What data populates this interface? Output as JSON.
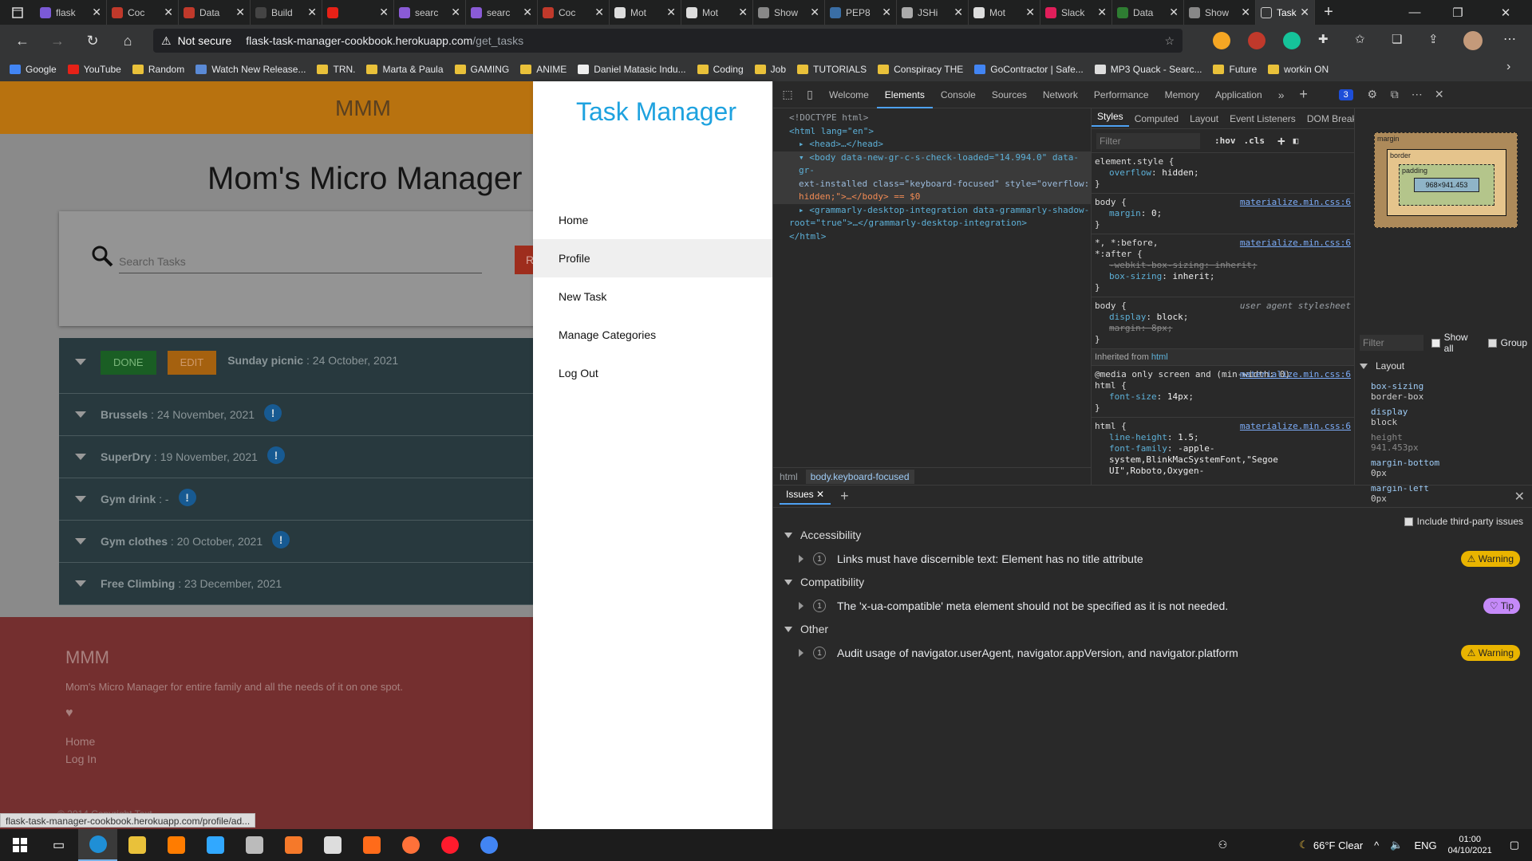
{
  "browser": {
    "tabs": [
      {
        "label": "flask",
        "color": "#7b5ad6"
      },
      {
        "label": "Coc",
        "color": "#c0392b"
      },
      {
        "label": "Data",
        "color": "#c0392b"
      },
      {
        "label": "Build",
        "color": "#444"
      },
      {
        "label": "",
        "color": "#e62117"
      },
      {
        "label": "searc",
        "color": "#8a5bd6"
      },
      {
        "label": "searc",
        "color": "#8a5bd6"
      },
      {
        "label": "Coc",
        "color": "#c0392b"
      },
      {
        "label": "Mot",
        "color": "#ddd"
      },
      {
        "label": "Mot",
        "color": "#ddd"
      },
      {
        "label": "Show",
        "color": "#888"
      },
      {
        "label": "PEP8",
        "color": "#3a6ea5"
      },
      {
        "label": "JSHi",
        "color": "#aaa"
      },
      {
        "label": "Mot",
        "color": "#ddd"
      },
      {
        "label": "Slack",
        "color": "#e01e5a"
      },
      {
        "label": "Data",
        "color": "#2e7d32"
      },
      {
        "label": "Show",
        "color": "#888"
      }
    ],
    "active_tab": "Task",
    "address": {
      "warning": "Not secure",
      "host": "flask-task-manager-cookbook.herokuapp.com",
      "path": "/get_tasks"
    },
    "bookmarks": [
      {
        "label": "Google",
        "color": "#4285f4"
      },
      {
        "label": "YouTube",
        "color": "#e62117"
      },
      {
        "label": "Random",
        "color": "#e9c13a"
      },
      {
        "label": "Watch New Release...",
        "color": "#5a8ad6"
      },
      {
        "label": "TRN.",
        "color": "#e9c13a"
      },
      {
        "label": "Marta & Paula",
        "color": "#e9c13a"
      },
      {
        "label": "GAMING",
        "color": "#e9c13a"
      },
      {
        "label": "ANIME",
        "color": "#e9c13a"
      },
      {
        "label": "Daniel Matasic Indu...",
        "color": "#eee"
      },
      {
        "label": "Coding",
        "color": "#e9c13a"
      },
      {
        "label": "Job",
        "color": "#e9c13a"
      },
      {
        "label": "TUTORIALS",
        "color": "#e9c13a"
      },
      {
        "label": "Conspiracy THE",
        "color": "#e9c13a"
      },
      {
        "label": "GoContractor | Safe...",
        "color": "#4285f4"
      },
      {
        "label": "MP3 Quack - Searc...",
        "color": "#ddd"
      },
      {
        "label": "Future",
        "color": "#e9c13a"
      },
      {
        "label": "workin ON",
        "color": "#e9c13a"
      }
    ]
  },
  "site": {
    "brand": "MMM",
    "title": "Mom's Micro Manager",
    "search_placeholder": "Search Tasks",
    "reset_label": "R",
    "done_label": "DONE",
    "edit_label": "EDIT",
    "tasks": [
      {
        "name": "Sunday picnic",
        "date": " : 24 October, 2021",
        "info": false
      },
      {
        "name": "Brussels",
        "date": " : 24 November, 2021",
        "info": true
      },
      {
        "name": "SuperDry",
        "date": " : 19 November, 2021",
        "info": true
      },
      {
        "name": "Gym drink",
        "date": " : -",
        "info": true
      },
      {
        "name": "Gym clothes",
        "date": " : 20 October, 2021",
        "info": true
      },
      {
        "name": "Free Climbing",
        "date": " : 23 December, 2021",
        "info": false
      }
    ],
    "footer": {
      "brand": "MMM",
      "description": "Mom's Micro Manager for entire family and all the needs of it on one spot.",
      "links": [
        "Home",
        "Log In"
      ],
      "copyright": "© 2014 Copyright Text"
    },
    "status_url": "flask-task-manager-cookbook.herokuapp.com/profile/ad..."
  },
  "sidenav": {
    "logo": "Task Manager",
    "items": [
      "Home",
      "Profile",
      "New Task",
      "Manage Categories",
      "Log Out"
    ]
  },
  "devtools": {
    "tabs": [
      "Welcome",
      "Elements",
      "Console",
      "Sources",
      "Network",
      "Performance",
      "Memory",
      "Application"
    ],
    "issue_count": "3",
    "dom": {
      "doctype": "<!DOCTYPE html>",
      "html_open": "<html lang=\"en\">",
      "head": "<head>…</head>",
      "body_line1": "<body data-new-gr-c-s-check-loaded=\"14.994.0\" data-gr-",
      "body_line2": "ext-installed class=\"keyboard-focused\" style=\"overflow:",
      "body_line3": "hidden;\">…</body> == $0",
      "gram_line1": "<grammarly-desktop-integration data-grammarly-shadow-",
      "gram_line2": "root=\"true\">…</grammarly-desktop-integration>",
      "html_close": "</html>"
    },
    "breadcrumb": [
      "html",
      "body.keyboard-focused"
    ],
    "styles_tabs": [
      "Styles",
      "Computed",
      "Layout",
      "Event Listeners",
      "DOM Breakpoints",
      "Properties"
    ],
    "filter_placeholder": "Filter",
    "hov": ":hov",
    "cls": ".cls",
    "rules": [
      {
        "selector": "element.style {",
        "props": [
          [
            "overflow",
            "hidden"
          ]
        ],
        "src": ""
      },
      {
        "selector": "body {",
        "props": [
          [
            "margin",
            "0"
          ]
        ],
        "src": "materialize.min.css:6"
      },
      {
        "selector": "*, *:before,\n*:after {",
        "props": [
          [
            "-webkit-box-sizing",
            "inherit",
            "strike"
          ],
          [
            "box-sizing",
            "inherit"
          ]
        ],
        "src": "materialize.min.css:6"
      },
      {
        "selector": "body {",
        "props": [
          [
            "display",
            "block"
          ],
          [
            "margin",
            "8px",
            "strike"
          ]
        ],
        "src": "user agent stylesheet"
      }
    ],
    "inherited": {
      "label": "Inherited from ",
      "tag": "html"
    },
    "media_rule": {
      "media": "@media only screen and (min-width: 0)",
      "selector": "html {",
      "props": [
        [
          "font-size",
          "14px"
        ]
      ],
      "src": "materialize.min.css:6"
    },
    "html_rule": {
      "selector": "html {",
      "props": [
        [
          "line-height",
          "1.5"
        ],
        [
          "font-family",
          "-apple-system,BlinkMacSystemFont,\"Segoe UI\",Roboto,Oxygen-"
        ]
      ],
      "src": "materialize.min.css:6"
    },
    "boxmodel": {
      "margin": "margin",
      "border": "border",
      "padding": "padding",
      "content": "968×941.453",
      "dash": "–"
    },
    "layout_filter": "Filter",
    "show_all": "Show all",
    "group": "Group",
    "layout_title": "Layout",
    "layout_props": [
      {
        "k": "box-sizing",
        "v": "border-box"
      },
      {
        "k": "display",
        "v": "block"
      },
      {
        "k": "height",
        "v": "941.453px",
        "grey": true
      },
      {
        "k": "margin-bottom",
        "v": "0px"
      },
      {
        "k": "margin-left",
        "v": "0px"
      }
    ],
    "drawer_tab": "Issues",
    "third_party": "Include third-party issues",
    "categories": [
      {
        "name": "Accessibility",
        "issue": "Links must have discernible text: Element has no title attribute",
        "count": "1",
        "badge": "⚠ Warning",
        "kind": "warn"
      },
      {
        "name": "Compatibility",
        "issue": "The 'x-ua-compatible' meta element should not be specified as it is not needed.",
        "count": "1",
        "badge": "♡ Tip",
        "kind": "tip"
      },
      {
        "name": "Other",
        "issue": "Audit usage of navigator.userAgent, navigator.appVersion, and navigator.platform",
        "count": "1",
        "badge": "⚠ Warning",
        "kind": "warn"
      }
    ]
  },
  "taskbar": {
    "weather": "66°F Clear",
    "lang": "ENG",
    "time": "01:00",
    "date": "04/10/2021",
    "apps": [
      {
        "name": "edge",
        "color": "#1f8fd6"
      },
      {
        "name": "explorer",
        "color": "#e9c13a"
      },
      {
        "name": "illustrator",
        "color": "#ff7c00"
      },
      {
        "name": "photoshop",
        "color": "#31a8ff"
      },
      {
        "name": "app",
        "color": "#bbb"
      },
      {
        "name": "blender",
        "color": "#f5792a"
      },
      {
        "name": "unity",
        "color": "#ddd"
      },
      {
        "name": "sublime",
        "color": "#ff6b1a"
      },
      {
        "name": "firefox",
        "color": "#ff7139"
      },
      {
        "name": "opera",
        "color": "#ff1b2d"
      },
      {
        "name": "chrome",
        "color": "#4285f4"
      }
    ]
  }
}
